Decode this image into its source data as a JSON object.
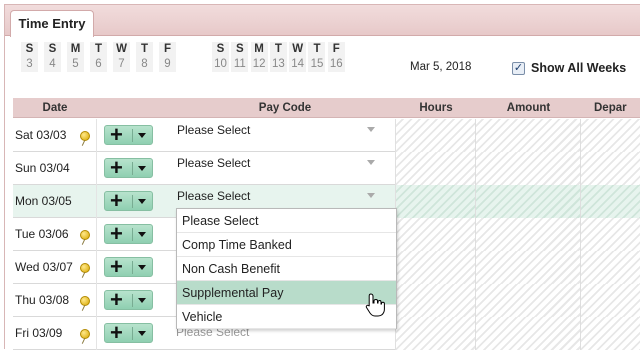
{
  "tab": {
    "label": "Time Entry"
  },
  "week_selector": {
    "week1": [
      {
        "letter": "S",
        "num": "3"
      },
      {
        "letter": "S",
        "num": "4"
      },
      {
        "letter": "M",
        "num": "5"
      },
      {
        "letter": "T",
        "num": "6"
      },
      {
        "letter": "W",
        "num": "7"
      },
      {
        "letter": "T",
        "num": "8"
      },
      {
        "letter": "F",
        "num": "9"
      }
    ],
    "week2": [
      {
        "letter": "S",
        "num": "10"
      },
      {
        "letter": "S",
        "num": "11"
      },
      {
        "letter": "M",
        "num": "12"
      },
      {
        "letter": "T",
        "num": "13"
      },
      {
        "letter": "W",
        "num": "14"
      },
      {
        "letter": "T",
        "num": "15"
      },
      {
        "letter": "F",
        "num": "16"
      }
    ],
    "selected_index": 2
  },
  "current_date": "Mar 5, 2018",
  "show_all_weeks": {
    "label": "Show All Weeks",
    "checked": true,
    "check_glyph": "✓"
  },
  "columns": {
    "date": "Date",
    "pay_code": "Pay Code",
    "hours": "Hours",
    "amount": "Amount",
    "department": "Depar"
  },
  "rows": [
    {
      "date": "Sat 03/03",
      "pin": true,
      "pay_code": "Please Select"
    },
    {
      "date": "Sun 03/04",
      "pin": false,
      "pay_code": "Please Select"
    },
    {
      "date": "Mon 03/05",
      "pin": false,
      "pay_code": "Please Select"
    },
    {
      "date": "Tue 03/06",
      "pin": true,
      "pay_code": ""
    },
    {
      "date": "Wed 03/07",
      "pin": true,
      "pay_code": ""
    },
    {
      "date": "Thu 03/08",
      "pin": true,
      "pay_code": ""
    },
    {
      "date": "Fri 03/09",
      "pin": true,
      "pay_code": "Please Select"
    }
  ],
  "dropdown_options": [
    "Please Select",
    "Comp Time Banked",
    "Non Cash Benefit",
    "Supplemental Pay",
    "Vehicle"
  ],
  "dropdown_highlighted_index": 3,
  "icons": {
    "add": "plus-icon",
    "menu": "chevron-down-icon",
    "pin": "pushpin-icon",
    "cursor": "hand-pointer-icon"
  },
  "colors": {
    "tab_strip": "#e7c9c9",
    "header": "#e6cccc",
    "add_button": "#8fcfb1",
    "active_row": "#e7f4ee",
    "highlight": "#b8dcca"
  }
}
